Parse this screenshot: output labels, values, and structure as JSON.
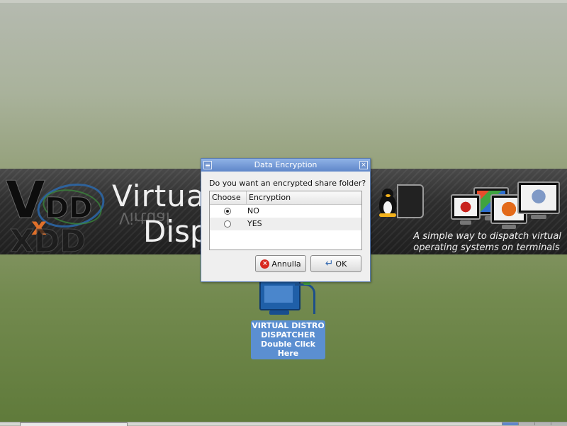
{
  "dialog": {
    "title": "Data Encryption",
    "question": "Do you want an encrypted share folder?",
    "columns": [
      "Choose",
      "Encryption"
    ],
    "rows": [
      {
        "label": "NO",
        "selected": true
      },
      {
        "label": "YES",
        "selected": false
      }
    ],
    "cancel_label": "Annulla",
    "ok_label": "OK"
  },
  "banner": {
    "logo": "VDD",
    "title_line1": "Virtual",
    "title_line2": "Dispa",
    "tagline_line1": "A simple way to dispatch virtual",
    "tagline_line2": "operating systems on terminals"
  },
  "desktop_icon": {
    "label_line1": "VIRTUAL DISTRO",
    "label_line2": "DISPATCHER",
    "label_line3": "Double Click",
    "label_line4": "Here",
    "icon": "monitor-network-icon"
  },
  "colors": {
    "dialog_title_bar": "#5f86c9",
    "desktop_label_bg": "#5b8fd1",
    "cancel_icon": "#d8281e"
  }
}
